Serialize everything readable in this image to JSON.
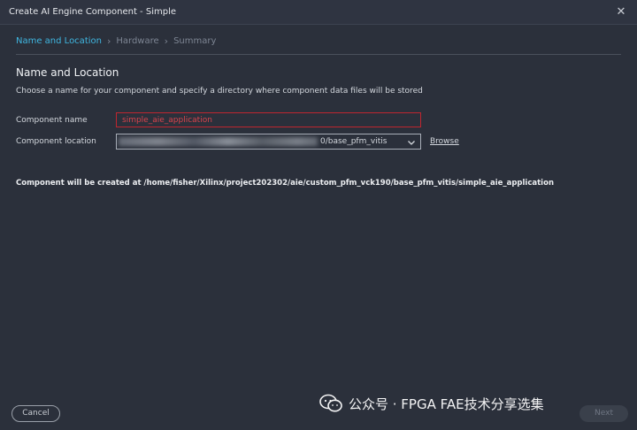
{
  "window": {
    "title": "Create AI Engine Component - Simple"
  },
  "breadcrumb": {
    "steps": [
      "Name and Location",
      "Hardware",
      "Summary"
    ]
  },
  "section": {
    "title": "Name and Location",
    "description": "Choose a name for your component and specify a directory where component data files will be stored"
  },
  "form": {
    "name_label": "Component name",
    "name_value": "simple_aie_application",
    "location_label": "Component location",
    "location_value": "0/base_pfm_vitis",
    "browse_label": "Browse"
  },
  "info": "Component will be created at /home/fisher/Xilinx/project202302/aie/custom_pfm_vck190/base_pfm_vitis/simple_aie_application",
  "footer": {
    "cancel_label": "Cancel",
    "next_label": "Next",
    "watermark": "公众号 · FPGA FAE技术分享选集"
  },
  "colors": {
    "accent": "#3fb6e0",
    "error": "#c0262f",
    "background": "#2b303b"
  }
}
